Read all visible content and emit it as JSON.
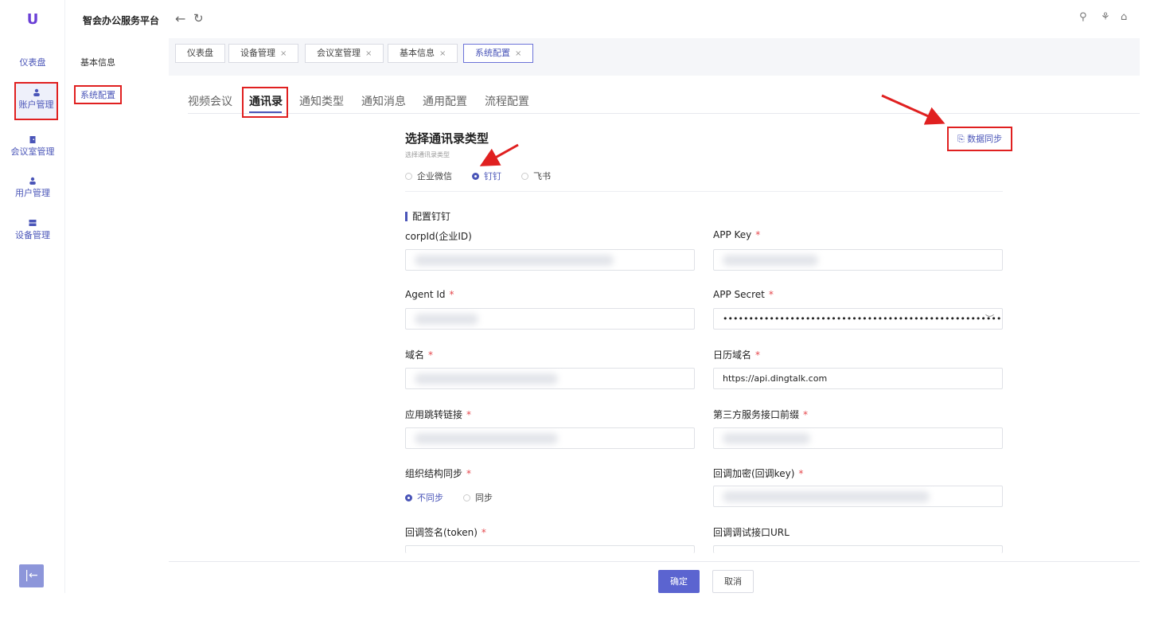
{
  "app": {
    "logo": "U",
    "brand": "智会办公服务平台"
  },
  "rail": [
    {
      "label": "仪表盘"
    },
    {
      "label": "账户管理"
    },
    {
      "label": "会议室管理"
    },
    {
      "label": "用户管理"
    },
    {
      "label": "设备管理"
    }
  ],
  "submenu": [
    {
      "label": "基本信息"
    },
    {
      "label": "系统配置"
    }
  ],
  "header": {
    "back_icon": "←",
    "refresh_icon": "↻",
    "search_icon": "⚲",
    "shirt_icon": "⚘",
    "lock_icon": "⌂"
  },
  "tabs": [
    {
      "label": "仪表盘"
    },
    {
      "label": "设备管理"
    },
    {
      "label": "会议室管理"
    },
    {
      "label": "基本信息"
    },
    {
      "label": "系统配置"
    }
  ],
  "tab_close": "×",
  "inner_tabs": [
    {
      "label": "视频会议"
    },
    {
      "label": "通讯录"
    },
    {
      "label": "通知类型"
    },
    {
      "label": "通知消息"
    },
    {
      "label": "通用配置"
    },
    {
      "label": "流程配置"
    }
  ],
  "section": {
    "title": "选择通讯录类型",
    "subtitle": "选择通讯录类型",
    "types": [
      {
        "label": "企业微信",
        "selected": false
      },
      {
        "label": "钉钉",
        "selected": true
      },
      {
        "label": "飞书",
        "selected": false
      }
    ],
    "sync_button": "数据同步",
    "config_header": "配置钉钉"
  },
  "fields": {
    "corp_id": {
      "label": "corpId(企业ID)"
    },
    "app_key": {
      "label": "APP Key",
      "required": "*"
    },
    "agent_id": {
      "label": "Agent Id",
      "required": "*"
    },
    "app_secret": {
      "label": "APP Secret",
      "required": "*",
      "value": "•••••••••••••••••••••••••••••••••••••••••••••••••••••••••••••••"
    },
    "domain": {
      "label": "域名",
      "required": "*"
    },
    "calendar_domain": {
      "label": "日历域名",
      "required": "*",
      "value": "https://api.dingtalk.com"
    },
    "app_jump_link": {
      "label": "应用跳转链接",
      "required": "*"
    },
    "third_party_prefix": {
      "label": "第三方服务接口前缀",
      "required": "*"
    },
    "org_sync": {
      "label": "组织结构同步",
      "required": "*",
      "options": [
        {
          "label": "不同步",
          "selected": true
        },
        {
          "label": "同步",
          "selected": false
        }
      ]
    },
    "callback_encrypt": {
      "label": "回调加密(回调key)",
      "required": "*"
    },
    "callback_sign": {
      "label": "回调签名(token)",
      "required": "*"
    },
    "callback_debug_url": {
      "label": "回调调试接口URL"
    }
  },
  "footer": {
    "ok": "确定",
    "cancel": "取消"
  },
  "colors": {
    "accent": "#4a55b8",
    "highlight": "#e02020"
  }
}
